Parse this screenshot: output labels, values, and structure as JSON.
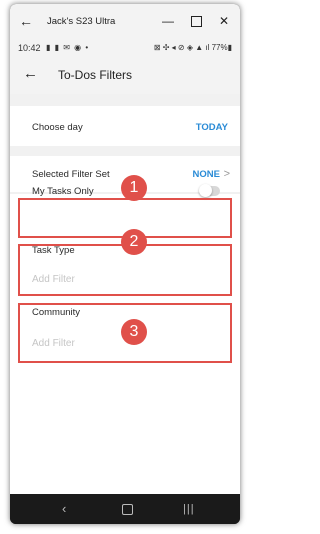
{
  "window": {
    "title": "Jack's S23 Ultra",
    "back_glyph": "←",
    "minimize_glyph": "—",
    "close_glyph": "✕"
  },
  "statusbar": {
    "time": "10:42",
    "left_icons": "▮ ▮ ✉ ◉ •",
    "right": "⊠ ✣ ◂ ⊘ ◈ ▲ ıl 77%▮"
  },
  "appbar": {
    "back_glyph": "←",
    "title": "To-Dos Filters"
  },
  "choose_day": {
    "label": "Choose day",
    "value": "TODAY"
  },
  "filter_set": {
    "label": "Selected Filter Set",
    "value": "NONE",
    "chevron": ">"
  },
  "filters": {
    "my_tasks_only": {
      "label": "My Tasks Only",
      "enabled": false
    },
    "task_type": {
      "label": "Task Type",
      "placeholder": "Add Filter"
    },
    "community": {
      "label": "Community",
      "placeholder": "Add Filter"
    }
  },
  "annotations": {
    "badge_color": "#e0504a",
    "items": [
      "1",
      "2",
      "3"
    ]
  },
  "navbar": {
    "back_glyph": "‹",
    "recents_glyph": "|||"
  },
  "colors": {
    "accent": "#2a8bd6",
    "highlight": "#e0504a"
  }
}
